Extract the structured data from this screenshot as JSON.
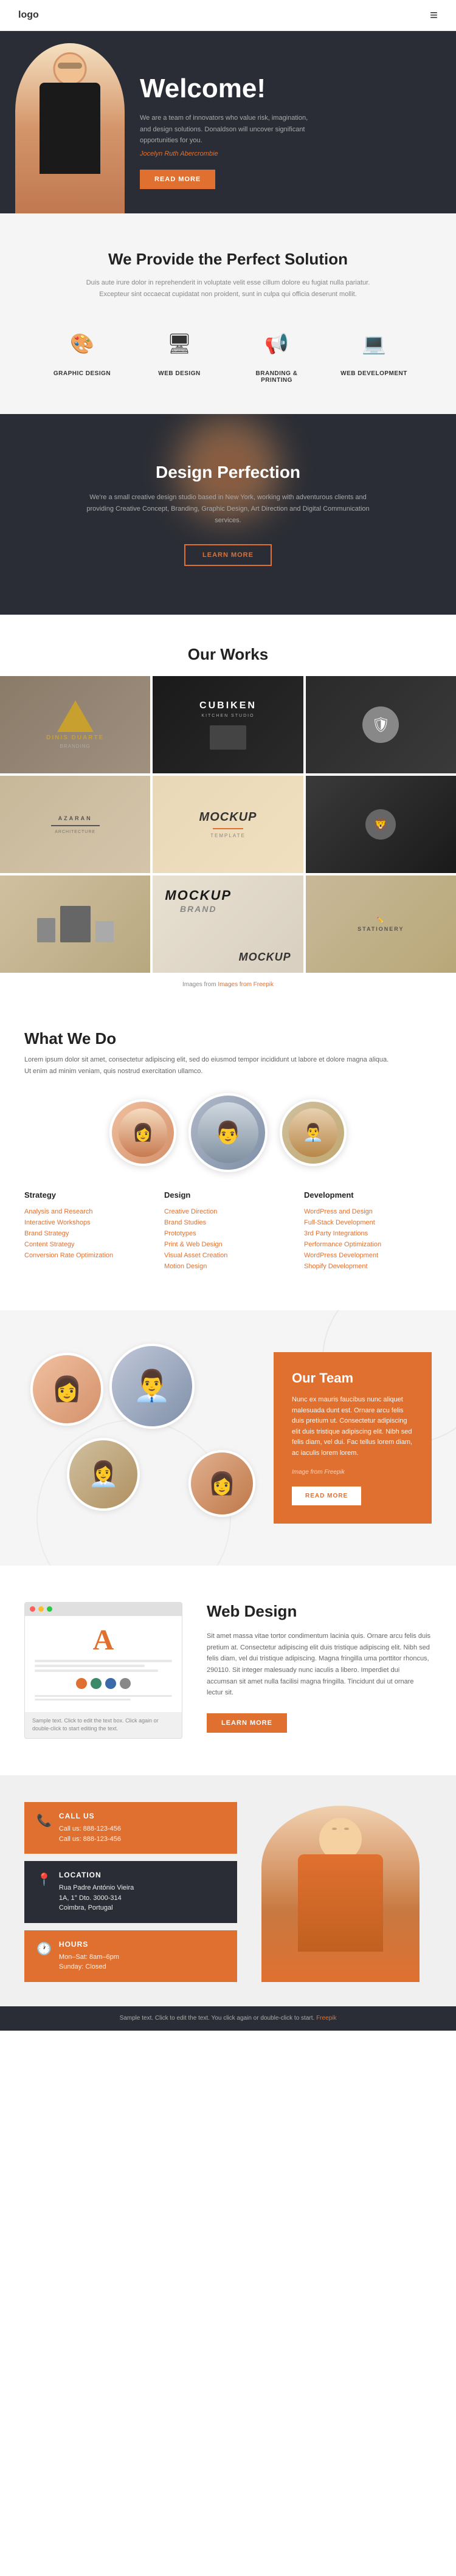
{
  "nav": {
    "logo": "logo",
    "hamburger": "≡"
  },
  "hero": {
    "title": "Welcome!",
    "subtitle": "We are a team of innovators who value risk, imagination, and design solutions. Donaldson will uncover significant opportunities for you.",
    "author": "Jocelyn Ruth Abercrombie",
    "cta": "READ MORE"
  },
  "services": {
    "title": "We Provide the Perfect Solution",
    "subtitle": "Duis aute irure dolor in reprehenderit in voluptate velit esse cillum dolore eu fugiat nulla pariatur. Excepteur sint occaecat cupidatat non proident, sunt in culpa qui officia deserunt mollit.",
    "items": [
      {
        "icon": "🎨",
        "label": "GRAPHIC DESIGN"
      },
      {
        "icon": "🖥",
        "label": "WEB DESIGN"
      },
      {
        "icon": "📢",
        "label": "BRANDING & PRINTING"
      },
      {
        "icon": "💻",
        "label": "WEB DEVELOPMENT"
      }
    ]
  },
  "design_perfection": {
    "title": "Design Perfection",
    "subtitle": "We're a small creative design studio based in New York, working with adventurous clients and providing Creative Concept, Branding, Graphic Design, Art Direction and Digital Communication services.",
    "cta": "LEARN MORE"
  },
  "our_works": {
    "title": "Our Works",
    "caption": "Images from Freepik"
  },
  "what_we_do": {
    "title": "What We Do",
    "intro": "Lorem ipsum dolor sit amet, consectetur adipiscing elit, sed do eiusmod tempor incididunt ut labore et dolore magna aliqua. Ut enim ad minim veniam, quis nostrud exercitation ullamco.",
    "columns": [
      {
        "title": "Strategy",
        "items": [
          "Analysis and Research",
          "Interactive Workshops",
          "Brand Strategy",
          "Content Strategy",
          "Conversion Rate Optimization"
        ]
      },
      {
        "title": "Design",
        "items": [
          "Creative Direction",
          "Brand Studies",
          "Prototypes",
          "Print & Web Design",
          "Visual Asset Creation",
          "Motion Design"
        ]
      },
      {
        "title": "Development",
        "items": [
          "WordPress and Design",
          "Full-Stack Development",
          "3rd Party Integrations",
          "Performance Optimization",
          "WordPress Development",
          "Shopify Development"
        ]
      }
    ]
  },
  "team": {
    "title": "Our Team",
    "text": "Nunc ex mauris faucibus nunc aliquet malesuada dunt est. Ornare arcu felis duis pretium ut. Consectetur adipiscing elit duis tristique adipiscing elit. Nibh sed felis diam, vel dui. Fac tellus lorem diam, ac iaculis lorem lorem.",
    "author": "Image from Freepik",
    "cta": "READ MORE"
  },
  "web_design": {
    "title": "Web Design",
    "text": "Sit amet massa vitae tortor condimentum lacinia quis. Ornare arcu felis duis pretium at. Consectetur adipiscing elit duis tristique adipiscing elit. Nibh sed felis diam, vel dui tristique adipiscing. Magna fringilla uma porttitor rhoncus, 290110. Sit integer malesuady nunc iaculis a libero. Imperdiet dui accumsan sit amet nulla facilisi magna fringilla. Tincidunt dui ut ornare lectur sit.",
    "cta": "LEARN MORE",
    "mock_title": "A",
    "mock_caption": "Sample text. Click to edit the text box. Click again or double-click to start editing the text.",
    "colors": [
      "#e07030",
      "#3a8a6a",
      "#3a6aaa",
      "#888888"
    ]
  },
  "contact": {
    "call": {
      "icon": "📞",
      "title": "CALL US",
      "lines": [
        "Call us: 888-123-456",
        "Call us: 888-123-456"
      ]
    },
    "location": {
      "icon": "📍",
      "title": "LOCATION",
      "lines": [
        "Rua Padre António Vieira",
        "1A, 1° Dto. 3000-314",
        "Coimbra, Portugal"
      ]
    },
    "hours": {
      "icon": "🕐",
      "title": "HOURS",
      "lines": [
        "Mon–Sat: 8am–6pm",
        "Sunday: Closed"
      ]
    }
  },
  "footer": {
    "text": "Sample text. Click to edit the text. You click again or double-click to start.",
    "credit": "Freepik"
  }
}
